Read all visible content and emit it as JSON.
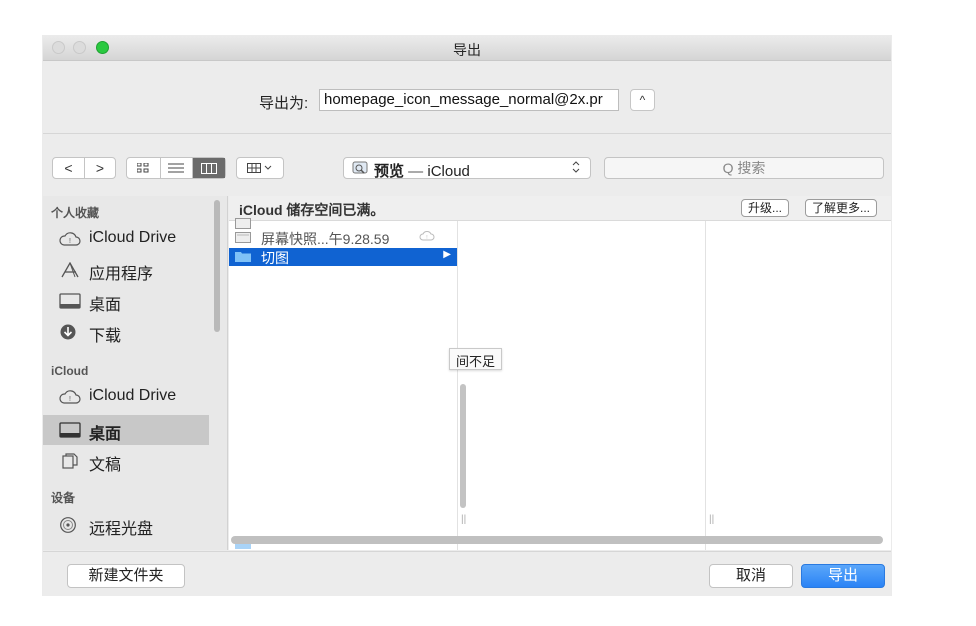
{
  "window": {
    "title": "导出"
  },
  "export_as": {
    "label": "导出为:",
    "filename": "homepage_icon_message_normal@2x.pr",
    "expand_symbol": "^"
  },
  "toolbar": {
    "back_symbol": "<",
    "forward_symbol": ">",
    "view_icon_symbol": "▪▪",
    "view_list_symbol": "≡",
    "view_column_symbol": "▥",
    "arrange_symbol": "▦ ∨",
    "location_app": "预览",
    "location_separator": " — ",
    "location_place": "iCloud",
    "location_arrows": "⌃⌄",
    "search_placeholder": "Q 搜索"
  },
  "sidebar": {
    "favorites_header": "个人收藏",
    "favorites": [
      {
        "label": "iCloud Drive",
        "icon": "cloud-icon"
      },
      {
        "label": "应用程序",
        "icon": "applications-icon"
      },
      {
        "label": "桌面",
        "icon": "desktop-icon"
      },
      {
        "label": "下载",
        "icon": "download-icon"
      }
    ],
    "icloud_header": "iCloud",
    "icloud": [
      {
        "label": "iCloud Drive",
        "icon": "cloud-icon"
      },
      {
        "label": "桌面",
        "icon": "desktop-icon",
        "selected": true
      },
      {
        "label": "文稿",
        "icon": "documents-icon"
      }
    ],
    "devices_header": "设备",
    "devices": [
      {
        "label": "远程光盘",
        "icon": "disc-icon"
      }
    ]
  },
  "browser": {
    "banner_text": "iCloud 储存空间已满。",
    "upgrade_label": "升级...",
    "learn_more_label": "了解更多...",
    "rows": [
      {
        "label": "屏幕快照...午9.28.59",
        "icon": "screenshot-icon"
      },
      {
        "label": "切图",
        "icon": "folder-icon",
        "selected": true
      }
    ],
    "tooltip": "间不足",
    "accent_color": "#1063d2"
  },
  "bottom": {
    "new_folder_label": "新建文件夹",
    "cancel_label": "取消",
    "export_label": "导出"
  }
}
